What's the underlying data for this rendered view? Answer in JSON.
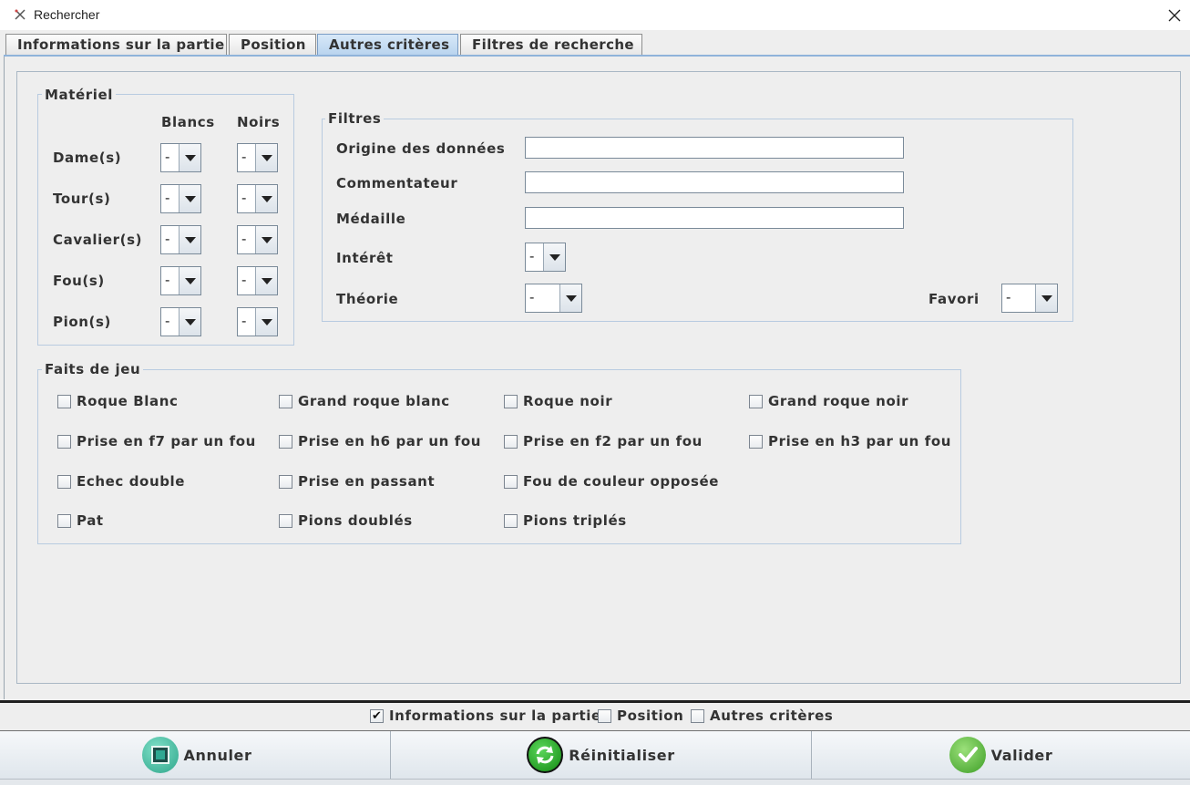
{
  "window": {
    "title": "Rechercher"
  },
  "tabs": [
    {
      "label": "Informations sur la partie"
    },
    {
      "label": "Position"
    },
    {
      "label": "Autres critères"
    },
    {
      "label": "Filtres de recherche"
    }
  ],
  "materiel": {
    "legend": "Matériel",
    "col_white": "Blancs",
    "col_black": "Noirs",
    "rows": [
      {
        "label": "Dame(s)",
        "white": "-",
        "black": "-"
      },
      {
        "label": "Tour(s)",
        "white": "-",
        "black": "-"
      },
      {
        "label": "Cavalier(s)",
        "white": "-",
        "black": "-"
      },
      {
        "label": "Fou(s)",
        "white": "-",
        "black": "-"
      },
      {
        "label": "Pion(s)",
        "white": "-",
        "black": "-"
      }
    ]
  },
  "filtres": {
    "legend": "Filtres",
    "origine_label": "Origine des données",
    "origine_value": "",
    "commentateur_label": "Commentateur",
    "commentateur_value": "",
    "medaille_label": "Médaille",
    "medaille_value": "",
    "interet_label": "Intérêt",
    "interet_value": "-",
    "theorie_label": "Théorie",
    "theorie_value": "-",
    "favori_label": "Favori",
    "favori_value": "-"
  },
  "faits": {
    "legend": "Faits de jeu",
    "items": [
      {
        "label": "Roque Blanc",
        "checked": false
      },
      {
        "label": "Grand roque blanc",
        "checked": false
      },
      {
        "label": "Roque noir",
        "checked": false
      },
      {
        "label": "Grand roque noir",
        "checked": false
      },
      {
        "label": "Prise en f7 par un fou",
        "checked": false
      },
      {
        "label": "Prise en h6 par un fou",
        "checked": false
      },
      {
        "label": "Prise en f2 par un fou",
        "checked": false
      },
      {
        "label": "Prise en h3 par un fou",
        "checked": false
      },
      {
        "label": "Echec double",
        "checked": false
      },
      {
        "label": "Prise en passant",
        "checked": false
      },
      {
        "label": "Fou de couleur opposée",
        "checked": false
      },
      {
        "label": "Pat",
        "checked": false
      },
      {
        "label": "Pions doublés",
        "checked": false
      },
      {
        "label": "Pions triplés",
        "checked": false
      }
    ]
  },
  "include": [
    {
      "label": "Informations sur la partie",
      "checked": true
    },
    {
      "label": "Position",
      "checked": false
    },
    {
      "label": "Autres critères",
      "checked": false
    }
  ],
  "buttons": {
    "cancel": "Annuler",
    "reset": "Réinitialiser",
    "ok": "Valider"
  },
  "colors": {
    "active_tab": "#b8d3ee",
    "cancel_icon": "#3fb89c",
    "reset_icon": "#2e9e2e",
    "ok_icon": "#55b83a"
  },
  "icons": {
    "app": "app-icon",
    "close": "close-icon",
    "cancel": "stop-icon",
    "reset": "refresh-icon",
    "ok": "check-icon"
  }
}
